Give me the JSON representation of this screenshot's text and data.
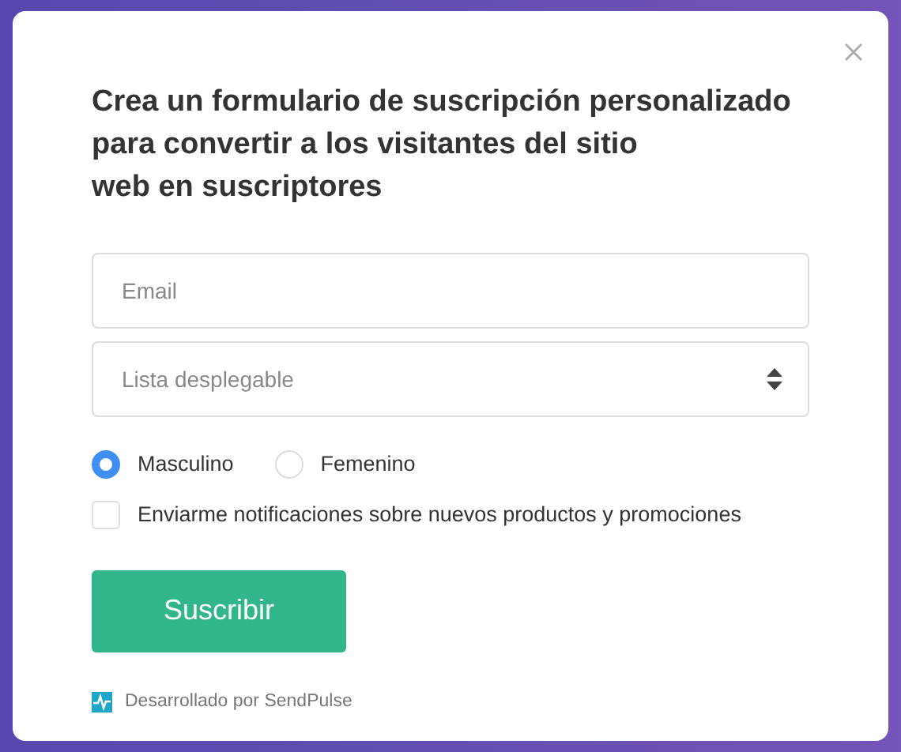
{
  "title": "Crea un formulario de suscripción personalizado\npara convertir a los visitantes del sitio\nweb en suscriptores",
  "email": {
    "placeholder": "Email"
  },
  "dropdown": {
    "placeholder": "Lista desplegable"
  },
  "gender": [
    {
      "label": "Masculino",
      "selected": true
    },
    {
      "label": "Femenino",
      "selected": false
    }
  ],
  "consent": {
    "label": "Enviarme notificaciones sobre nuevos productos y promociones",
    "checked": false
  },
  "submit": "Suscribir",
  "footer": "Desarrollado por SendPulse"
}
